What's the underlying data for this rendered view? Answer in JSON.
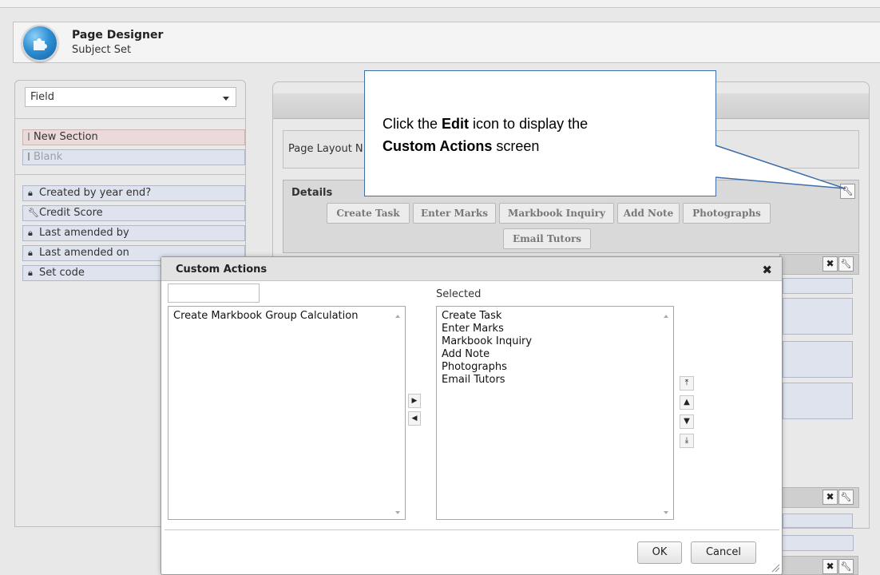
{
  "header": {
    "title": "Page Designer",
    "subtitle": "Subject Set"
  },
  "left_panel": {
    "field_select": "Field",
    "section_items": [
      {
        "label": "New Section",
        "style": "pink"
      },
      {
        "label": "Blank",
        "style": "faded"
      }
    ],
    "field_items": [
      {
        "label": "Created by year end?",
        "icon": "lock-icon"
      },
      {
        "label": "Credit Score",
        "icon": "wrench-icon"
      },
      {
        "label": "Last amended by",
        "icon": "lock-icon"
      },
      {
        "label": "Last amended on",
        "icon": "lock-icon"
      },
      {
        "label": "Set code",
        "icon": "lock-icon"
      }
    ]
  },
  "right_panel": {
    "page_layout_label": "Page Layout N",
    "details_label": "Details",
    "actions": [
      "Create Task",
      "Enter Marks",
      "Markbook Inquiry",
      "Add Note",
      "Photographs",
      "Email Tutors"
    ]
  },
  "callout": {
    "text_pre": "Click the ",
    "bold1": "Edit",
    "text_mid": " icon to display the ",
    "bold2": "Custom Actions",
    "text_post": " screen"
  },
  "dialog": {
    "title": "Custom Actions",
    "filter_value": "",
    "available_items": [
      "Create Markbook Group Calculation"
    ],
    "selected_label": "Selected",
    "selected_items": [
      "Create Task",
      "Enter Marks",
      "Markbook Inquiry",
      "Add Note",
      "Photographs",
      "Email Tutors"
    ],
    "ok_label": "OK",
    "cancel_label": "Cancel"
  },
  "colors": {
    "callout_border": "#3f6ea8",
    "chip_blue": "#dfe3ee",
    "chip_pink": "#ecd9d9",
    "app_icon": "#2f90d6"
  }
}
